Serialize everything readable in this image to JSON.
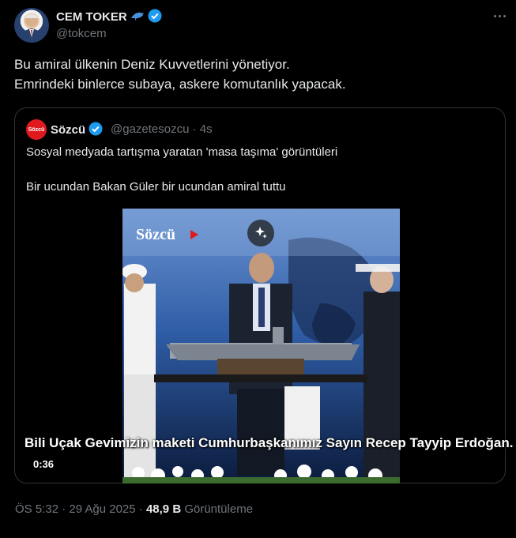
{
  "author": {
    "name": "CEM TOKER",
    "handle": "@tokcem",
    "avatar_icon": "user-avatar-photo"
  },
  "tweet": {
    "line1": "Bu amiral ülkenin Deniz Kuvvetlerini yönetiyor.",
    "line2": "Emrindeki binlerce subaya, askere komutanlık yapacak."
  },
  "quote": {
    "logo_text": "Sözcü",
    "name": "Sözcü",
    "handle_time": "@gazetesozcu · 4s",
    "text1": "Sosyal medyada tartışma yaratan 'masa taşıma' görüntüleri",
    "text2": "Bir ucundan Bakan Güler bir ucundan amiral tuttu",
    "video": {
      "watermark": "Sözcü",
      "caption": "Bili Uçak Gevimizin maketi Cumhurbaşkanımız Sayın Recep Tayyip Erdoğan.",
      "duration": "0:36"
    }
  },
  "meta": {
    "timestamp": "ÖS 5:32 · 29 Ağu 2025 · ",
    "views": "48,9 B",
    "views_label": " Görüntüleme"
  },
  "colors": {
    "background": "#000000",
    "text": "#e7e9ea",
    "secondary": "#71767b",
    "verified": "#1d9bf0",
    "brand_red": "#e0191f"
  }
}
